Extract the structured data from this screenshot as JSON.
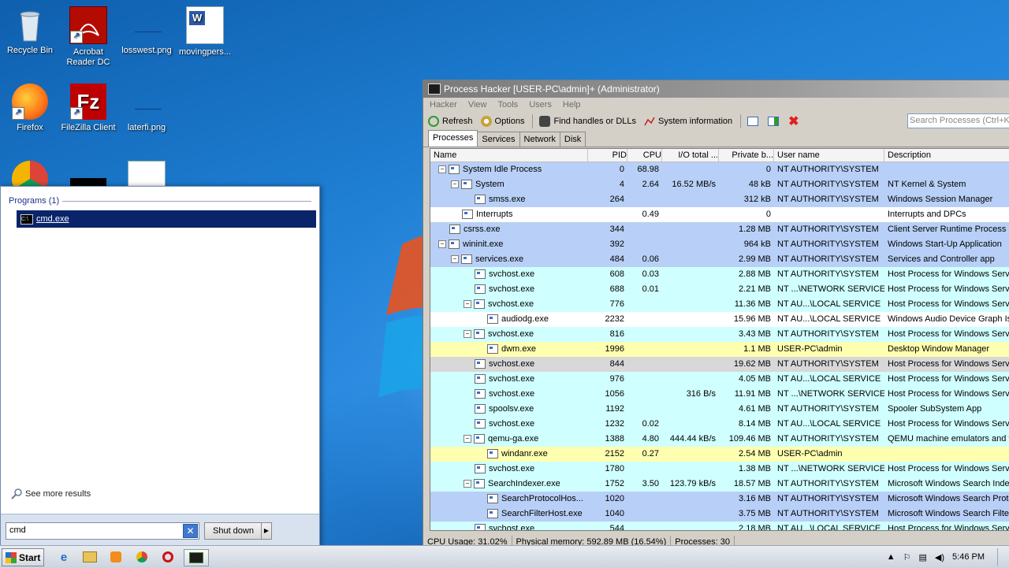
{
  "desktop": {
    "icons": [
      {
        "label": "Recycle Bin"
      },
      {
        "label": "Acrobat Reader DC"
      },
      {
        "label": "losswest.png"
      },
      {
        "label": "movingpers..."
      },
      {
        "label": "Firefox"
      },
      {
        "label": "FileZilla Client"
      },
      {
        "label": "laterfi.png"
      }
    ]
  },
  "start_menu": {
    "section_title": "Programs (1)",
    "result": "cmd.exe",
    "see_more": "See more results",
    "search_value": "cmd",
    "shutdown_label": "Shut down"
  },
  "process_hacker": {
    "title": "Process Hacker [USER-PC\\admin]+ (Administrator)",
    "menu": [
      "Hacker",
      "View",
      "Tools",
      "Users",
      "Help"
    ],
    "toolbar": {
      "refresh": "Refresh",
      "options": "Options",
      "find": "Find handles or DLLs",
      "sysinfo": "System information"
    },
    "search_placeholder": "Search Processes (Ctrl+K)",
    "tabs": [
      "Processes",
      "Services",
      "Network",
      "Disk"
    ],
    "columns": [
      "Name",
      "PID",
      "CPU",
      "I/O total ...",
      "Private b...",
      "User name",
      "Description"
    ],
    "rows": [
      {
        "name": "System Idle Process",
        "pid": "0",
        "cpu": "68.98",
        "io": "",
        "priv": "0",
        "user": "NT AUTHORITY\\SYSTEM",
        "desc": "",
        "indent": 0,
        "toggle": "-",
        "color": "#b8d0f7"
      },
      {
        "name": "System",
        "pid": "4",
        "cpu": "2.64",
        "io": "16.52 MB/s",
        "priv": "48 kB",
        "user": "NT AUTHORITY\\SYSTEM",
        "desc": "NT Kernel & System",
        "indent": 1,
        "toggle": "-",
        "color": "#b8d0f7"
      },
      {
        "name": "smss.exe",
        "pid": "264",
        "cpu": "",
        "io": "",
        "priv": "312 kB",
        "user": "NT AUTHORITY\\SYSTEM",
        "desc": "Windows Session Manager",
        "indent": 2,
        "toggle": "",
        "color": "#b8d0f7"
      },
      {
        "name": "Interrupts",
        "pid": "",
        "cpu": "0.49",
        "io": "",
        "priv": "0",
        "user": "",
        "desc": "Interrupts and DPCs",
        "indent": 1,
        "toggle": "",
        "color": "#ffffff"
      },
      {
        "name": "csrss.exe",
        "pid": "344",
        "cpu": "",
        "io": "",
        "priv": "1.28 MB",
        "user": "NT AUTHORITY\\SYSTEM",
        "desc": "Client Server Runtime Process",
        "indent": 0,
        "toggle": "",
        "color": "#b8d0f7"
      },
      {
        "name": "wininit.exe",
        "pid": "392",
        "cpu": "",
        "io": "",
        "priv": "964 kB",
        "user": "NT AUTHORITY\\SYSTEM",
        "desc": "Windows Start-Up Application",
        "indent": 0,
        "toggle": "-",
        "color": "#b8d0f7"
      },
      {
        "name": "services.exe",
        "pid": "484",
        "cpu": "0.06",
        "io": "",
        "priv": "2.99 MB",
        "user": "NT AUTHORITY\\SYSTEM",
        "desc": "Services and Controller app",
        "indent": 1,
        "toggle": "-",
        "color": "#b8d0f7"
      },
      {
        "name": "svchost.exe",
        "pid": "608",
        "cpu": "0.03",
        "io": "",
        "priv": "2.88 MB",
        "user": "NT AUTHORITY\\SYSTEM",
        "desc": "Host Process for Windows Servic",
        "indent": 2,
        "toggle": "",
        "color": "#d0ffff"
      },
      {
        "name": "svchost.exe",
        "pid": "688",
        "cpu": "0.01",
        "io": "",
        "priv": "2.21 MB",
        "user": "NT ...\\NETWORK SERVICE",
        "desc": "Host Process for Windows Servic",
        "indent": 2,
        "toggle": "",
        "color": "#d0ffff"
      },
      {
        "name": "svchost.exe",
        "pid": "776",
        "cpu": "",
        "io": "",
        "priv": "11.36 MB",
        "user": "NT AU...\\LOCAL SERVICE",
        "desc": "Host Process for Windows Servic",
        "indent": 2,
        "toggle": "-",
        "color": "#d0ffff"
      },
      {
        "name": "audiodg.exe",
        "pid": "2232",
        "cpu": "",
        "io": "",
        "priv": "15.96 MB",
        "user": "NT AU...\\LOCAL SERVICE",
        "desc": "Windows Audio Device Graph Is",
        "indent": 3,
        "toggle": "",
        "color": "#ffffff"
      },
      {
        "name": "svchost.exe",
        "pid": "816",
        "cpu": "",
        "io": "",
        "priv": "3.43 MB",
        "user": "NT AUTHORITY\\SYSTEM",
        "desc": "Host Process for Windows Servic",
        "indent": 2,
        "toggle": "-",
        "color": "#d0ffff"
      },
      {
        "name": "dwm.exe",
        "pid": "1996",
        "cpu": "",
        "io": "",
        "priv": "1.1 MB",
        "user": "USER-PC\\admin",
        "desc": "Desktop Window Manager",
        "indent": 3,
        "toggle": "",
        "color": "#ffffb0"
      },
      {
        "name": "svchost.exe",
        "pid": "844",
        "cpu": "",
        "io": "",
        "priv": "19.62 MB",
        "user": "NT AUTHORITY\\SYSTEM",
        "desc": "Host Process for Windows Servic",
        "indent": 2,
        "toggle": "",
        "color": "#d8d8d8"
      },
      {
        "name": "svchost.exe",
        "pid": "976",
        "cpu": "",
        "io": "",
        "priv": "4.05 MB",
        "user": "NT AU...\\LOCAL SERVICE",
        "desc": "Host Process for Windows Servic",
        "indent": 2,
        "toggle": "",
        "color": "#d0ffff"
      },
      {
        "name": "svchost.exe",
        "pid": "1056",
        "cpu": "",
        "io": "316 B/s",
        "priv": "11.91 MB",
        "user": "NT ...\\NETWORK SERVICE",
        "desc": "Host Process for Windows Servic",
        "indent": 2,
        "toggle": "",
        "color": "#d0ffff"
      },
      {
        "name": "spoolsv.exe",
        "pid": "1192",
        "cpu": "",
        "io": "",
        "priv": "4.61 MB",
        "user": "NT AUTHORITY\\SYSTEM",
        "desc": "Spooler SubSystem App",
        "indent": 2,
        "toggle": "",
        "color": "#d0ffff"
      },
      {
        "name": "svchost.exe",
        "pid": "1232",
        "cpu": "0.02",
        "io": "",
        "priv": "8.14 MB",
        "user": "NT AU...\\LOCAL SERVICE",
        "desc": "Host Process for Windows Servic",
        "indent": 2,
        "toggle": "",
        "color": "#d0ffff"
      },
      {
        "name": "qemu-ga.exe",
        "pid": "1388",
        "cpu": "4.80",
        "io": "444.44 kB/s",
        "priv": "109.46 MB",
        "user": "NT AUTHORITY\\SYSTEM",
        "desc": "QEMU machine emulators and to",
        "indent": 2,
        "toggle": "-",
        "color": "#d0ffff"
      },
      {
        "name": "windanr.exe",
        "pid": "2152",
        "cpu": "0.27",
        "io": "",
        "priv": "2.54 MB",
        "user": "USER-PC\\admin",
        "desc": "",
        "indent": 3,
        "toggle": "",
        "color": "#ffffb0"
      },
      {
        "name": "svchost.exe",
        "pid": "1780",
        "cpu": "",
        "io": "",
        "priv": "1.38 MB",
        "user": "NT ...\\NETWORK SERVICE",
        "desc": "Host Process for Windows Servic",
        "indent": 2,
        "toggle": "",
        "color": "#d0ffff"
      },
      {
        "name": "SearchIndexer.exe",
        "pid": "1752",
        "cpu": "3.50",
        "io": "123.79 kB/s",
        "priv": "18.57 MB",
        "user": "NT AUTHORITY\\SYSTEM",
        "desc": "Microsoft Windows Search Index",
        "indent": 2,
        "toggle": "-",
        "color": "#d0ffff"
      },
      {
        "name": "SearchProtocolHos...",
        "pid": "1020",
        "cpu": "",
        "io": "",
        "priv": "3.16 MB",
        "user": "NT AUTHORITY\\SYSTEM",
        "desc": "Microsoft Windows Search Proto",
        "indent": 3,
        "toggle": "",
        "color": "#b8d0f7"
      },
      {
        "name": "SearchFilterHost.exe",
        "pid": "1040",
        "cpu": "",
        "io": "",
        "priv": "3.75 MB",
        "user": "NT AUTHORITY\\SYSTEM",
        "desc": "Microsoft Windows Search Filter",
        "indent": 3,
        "toggle": "",
        "color": "#b8d0f7"
      },
      {
        "name": "svchost.exe",
        "pid": "544",
        "cpu": "",
        "io": "",
        "priv": "2.18 MB",
        "user": "NT AU...\\LOCAL SERVICE",
        "desc": "Host Process for Windows Servic",
        "indent": 2,
        "toggle": "",
        "color": "#d0ffff"
      }
    ],
    "status": {
      "cpu": "CPU Usage: 31.02%",
      "memory": "Physical memory: 592.89 MB (16.54%)",
      "processes": "Processes: 30"
    }
  },
  "taskbar": {
    "start_label": "Start",
    "clock": "5:46 PM"
  }
}
